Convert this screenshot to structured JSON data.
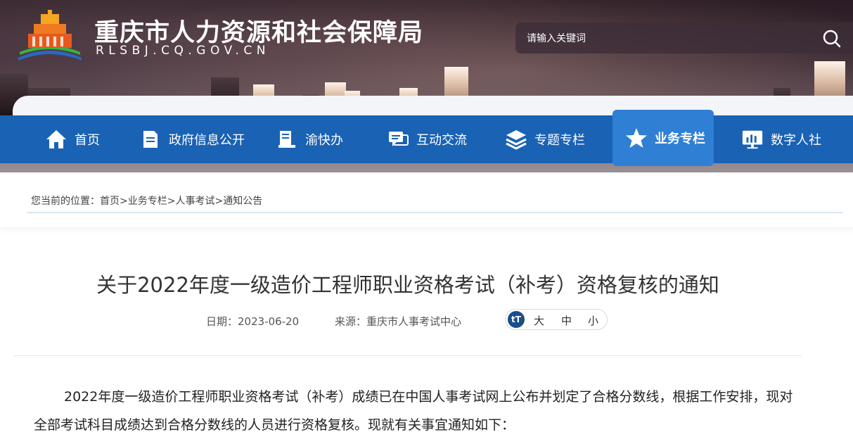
{
  "header": {
    "site_title": "重庆市人力资源和社会保障局",
    "site_domain": "RLSBJ.CQ.GOV.CN",
    "search_placeholder": "请输入关键词"
  },
  "nav": {
    "items": [
      {
        "label": "首页",
        "icon": "home-icon"
      },
      {
        "label": "政府信息公开",
        "icon": "document-icon"
      },
      {
        "label": "渝快办",
        "icon": "service-icon"
      },
      {
        "label": "互动交流",
        "icon": "chat-icon"
      },
      {
        "label": "专题专栏",
        "icon": "layers-icon"
      },
      {
        "label": "业务专栏",
        "icon": "star-icon",
        "active": true
      },
      {
        "label": "数字人社",
        "icon": "monitor-chart-icon"
      }
    ]
  },
  "breadcrumb": {
    "prefix": "您当前的位置：",
    "items": [
      "首页",
      "业务专栏",
      "人事考试",
      "通知公告"
    ],
    "separator": ">"
  },
  "article": {
    "title": "关于2022年度一级造价工程师职业资格考试（补考）资格复核的通知",
    "date": "日期：2023-06-20",
    "source": "来源：重庆市人事考试中心",
    "font_sizes": [
      "大",
      "中",
      "小"
    ],
    "body": "2022年度一级造价工程师职业资格考试（补考）成绩已在中国人事考试网上公布并划定了合格分数线，根据工作安排，现对全部考试科目成绩达到合格分数线的人员进行资格复核。现就有关事宜通知如下："
  },
  "colors": {
    "nav_bg": "#1a62b4",
    "nav_active": "#2f7fd4",
    "font_icon_bg": "#1a4d8c"
  }
}
